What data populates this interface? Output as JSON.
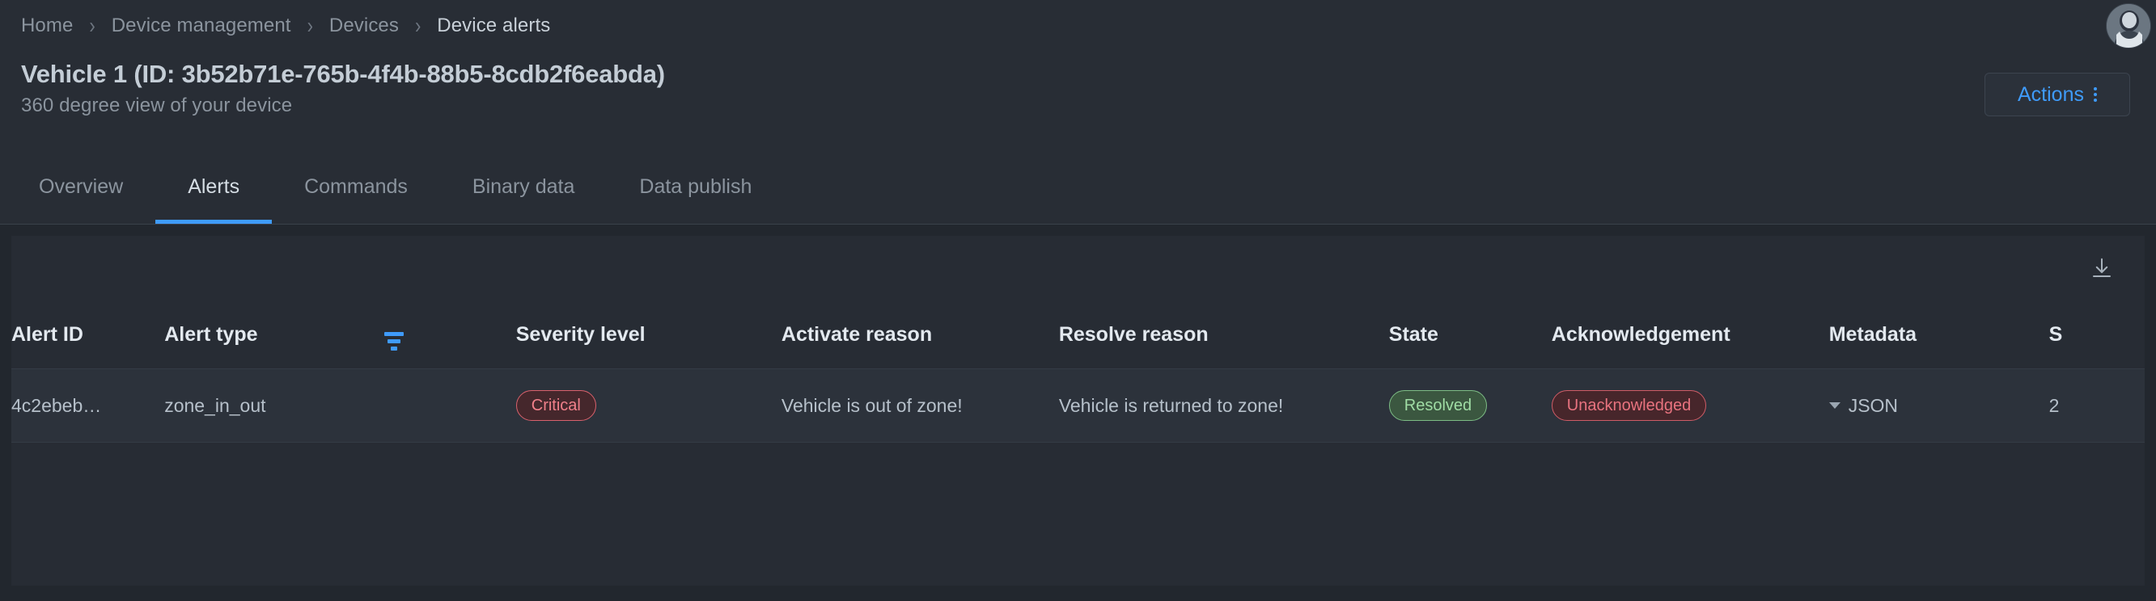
{
  "breadcrumb": {
    "items": [
      {
        "label": "Home",
        "current": false
      },
      {
        "label": "Device management",
        "current": false
      },
      {
        "label": "Devices",
        "current": false
      },
      {
        "label": "Device alerts",
        "current": true
      }
    ],
    "separator": "›"
  },
  "header": {
    "title": "Vehicle 1 (ID: 3b52b71e-765b-4f4b-88b5-8cdb2f6eabda)",
    "subtitle": "360 degree view of your device",
    "actions_label": "Actions",
    "avatar_name": "user-avatar"
  },
  "tabs": [
    {
      "label": "Overview",
      "active": false
    },
    {
      "label": "Alerts",
      "active": true
    },
    {
      "label": "Commands",
      "active": false
    },
    {
      "label": "Binary data",
      "active": false
    },
    {
      "label": "Data publish",
      "active": false
    }
  ],
  "toolbar": {
    "download_title": "Download"
  },
  "table": {
    "columns": [
      "Alert ID",
      "Alert type",
      "Severity level",
      "Activate reason",
      "Resolve reason",
      "State",
      "Acknowledgement",
      "Metadata",
      "S"
    ],
    "rows": [
      {
        "alert_id": "4c2ebeb…",
        "alert_type": "zone_in_out",
        "severity": "Critical",
        "activate_reason": "Vehicle is out of zone!",
        "resolve_reason": "Vehicle is returned to zone!",
        "state": "Resolved",
        "acknowledgement": "Unacknowledged",
        "metadata": "JSON",
        "last": "2"
      }
    ]
  },
  "colors": {
    "accent": "#3f9bfa",
    "page_bg": "#22272e",
    "panel_bg": "#272c34",
    "header_bg": "#282d35",
    "critical": "#f0808a",
    "resolved": "#9fdca4",
    "unacknowledged": "#e8737f"
  }
}
